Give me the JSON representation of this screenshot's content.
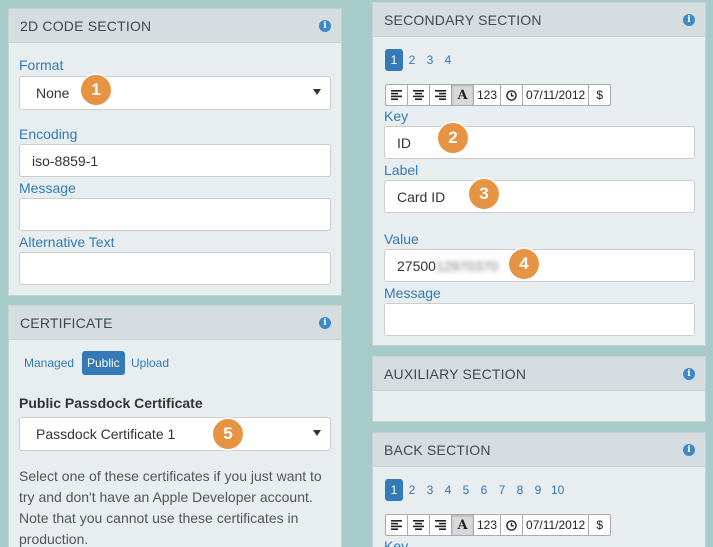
{
  "code_section": {
    "title": "2D CODE SECTION",
    "format_label": "Format",
    "format_value": "None",
    "encoding_label": "Encoding",
    "encoding_value": "iso-8859-1",
    "message_label": "Message",
    "message_value": "",
    "alt_text_label": "Alternative Text",
    "alt_text_value": ""
  },
  "certificate": {
    "title": "CERTIFICATE",
    "tabs": [
      "Managed",
      "Public",
      "Upload"
    ],
    "active_tab": "Public",
    "heading": "Public Passdock Certificate",
    "select_value": "Passdock Certificate 1",
    "help_lines": [
      "Select one of these certificates if you just want to",
      "try and don't have an Apple Developer account.",
      "Note that you cannot use these certificates in",
      "production."
    ]
  },
  "secondary": {
    "title": "SECONDARY SECTION",
    "pages": [
      "1",
      "2",
      "3",
      "4"
    ],
    "active_page": "1",
    "toolbar": {
      "num": "123",
      "date": "07/11/2012",
      "currency": "$"
    },
    "key_label": "Key",
    "key_value": "ID",
    "label_label": "Label",
    "label_value": "Card ID",
    "value_label": "Value",
    "value_prefix": "27500",
    "value_hidden": "12970370",
    "message_label": "Message",
    "message_value": ""
  },
  "auxiliary": {
    "title": "AUXILIARY SECTION"
  },
  "back": {
    "title": "BACK SECTION",
    "pages": [
      "1",
      "2",
      "3",
      "4",
      "5",
      "6",
      "7",
      "8",
      "9",
      "10"
    ],
    "active_page": "1",
    "toolbar": {
      "num": "123",
      "date": "07/11/2012",
      "currency": "$"
    },
    "key_label": "Key"
  },
  "badges": [
    "1",
    "2",
    "3",
    "4",
    "5"
  ],
  "colors": {
    "background": "#a7cbc8",
    "panel": "#e8eef0",
    "panel_header": "#d5dde0",
    "link": "#337ab7",
    "badge": "#e69343"
  },
  "icons": [
    "info-icon",
    "align-left-icon",
    "align-center-icon",
    "align-right-icon",
    "text-format-icon",
    "clock-icon",
    "chevron-down-icon"
  ]
}
